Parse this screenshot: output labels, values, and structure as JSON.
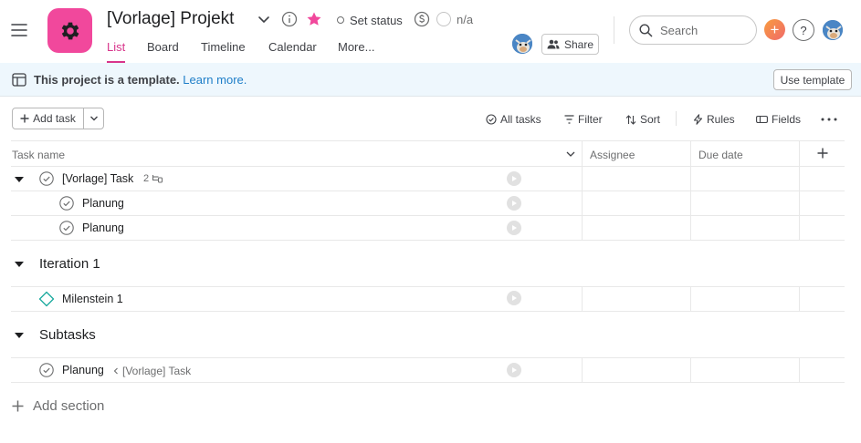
{
  "header": {
    "title": "[Vorlage] Projekt",
    "set_status": "Set status",
    "budget_status": "n/a",
    "share_label": "Share",
    "search_placeholder": "Search",
    "brand_color": "#f1489c",
    "accent_color": "#d8348b"
  },
  "tabs": [
    {
      "label": "List",
      "active": true
    },
    {
      "label": "Board",
      "active": false
    },
    {
      "label": "Timeline",
      "active": false
    },
    {
      "label": "Calendar",
      "active": false
    },
    {
      "label": "More...",
      "active": false
    }
  ],
  "banner": {
    "text": "This project is a template.",
    "link": "Learn more.",
    "button": "Use template"
  },
  "toolbar": {
    "add_task": "Add task",
    "all_tasks": "All tasks",
    "filter": "Filter",
    "sort": "Sort",
    "rules": "Rules",
    "fields": "Fields"
  },
  "table": {
    "columns": [
      "Task name",
      "Assignee",
      "Due date"
    ],
    "rows": [
      {
        "name": "[Vorlage] Task",
        "subtask_count": "2"
      },
      {
        "name": "Planung"
      },
      {
        "name": "Planung"
      }
    ],
    "sections": [
      {
        "title": "Iteration 1",
        "tasks": [
          {
            "name": "Milenstein 1",
            "type": "milestone"
          }
        ]
      },
      {
        "title": "Subtasks",
        "tasks": [
          {
            "name": "Planung",
            "parent": "[Vorlage] Task"
          }
        ]
      }
    ],
    "add_section": "Add section"
  },
  "icons": {
    "hamburger": "hamburger-icon",
    "app": "gear-icon",
    "chevron": "chevron-down-icon",
    "info": "info-icon",
    "star": "star-icon",
    "budget": "dollar-icon",
    "search": "search-icon",
    "help": "help-icon",
    "plus": "plus-icon"
  }
}
